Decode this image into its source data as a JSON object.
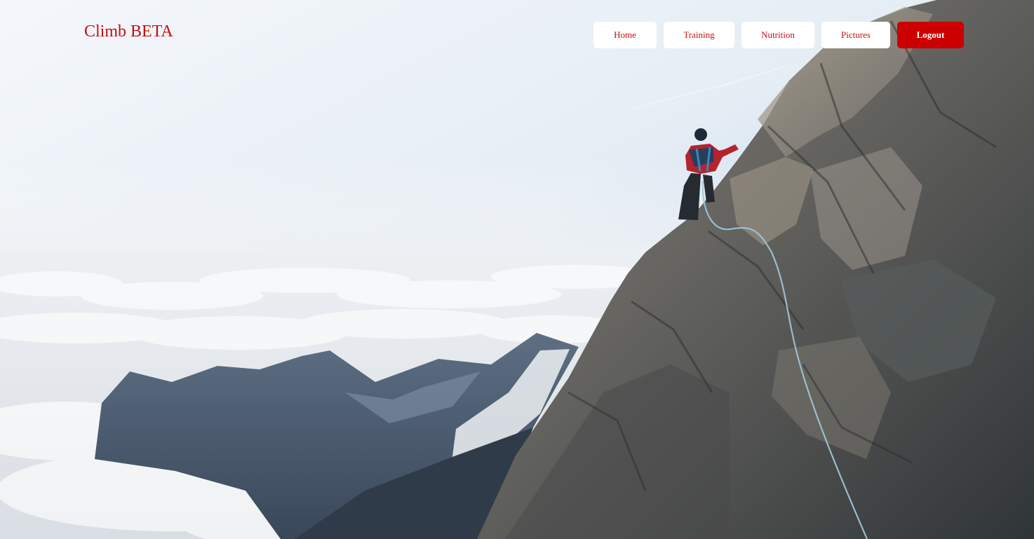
{
  "brand": {
    "title": "Climb BETA"
  },
  "nav": {
    "home": "Home",
    "training": "Training",
    "nutrition": "Nutrition",
    "pictures": "Pictures",
    "logout": "Logout"
  },
  "theme": {
    "accent": "#cc0000",
    "button_background": "#ffffff",
    "button_text": "#c80d0d"
  },
  "hero": {
    "image_subject": "climber-on-rocky-ridge-above-clouds"
  }
}
